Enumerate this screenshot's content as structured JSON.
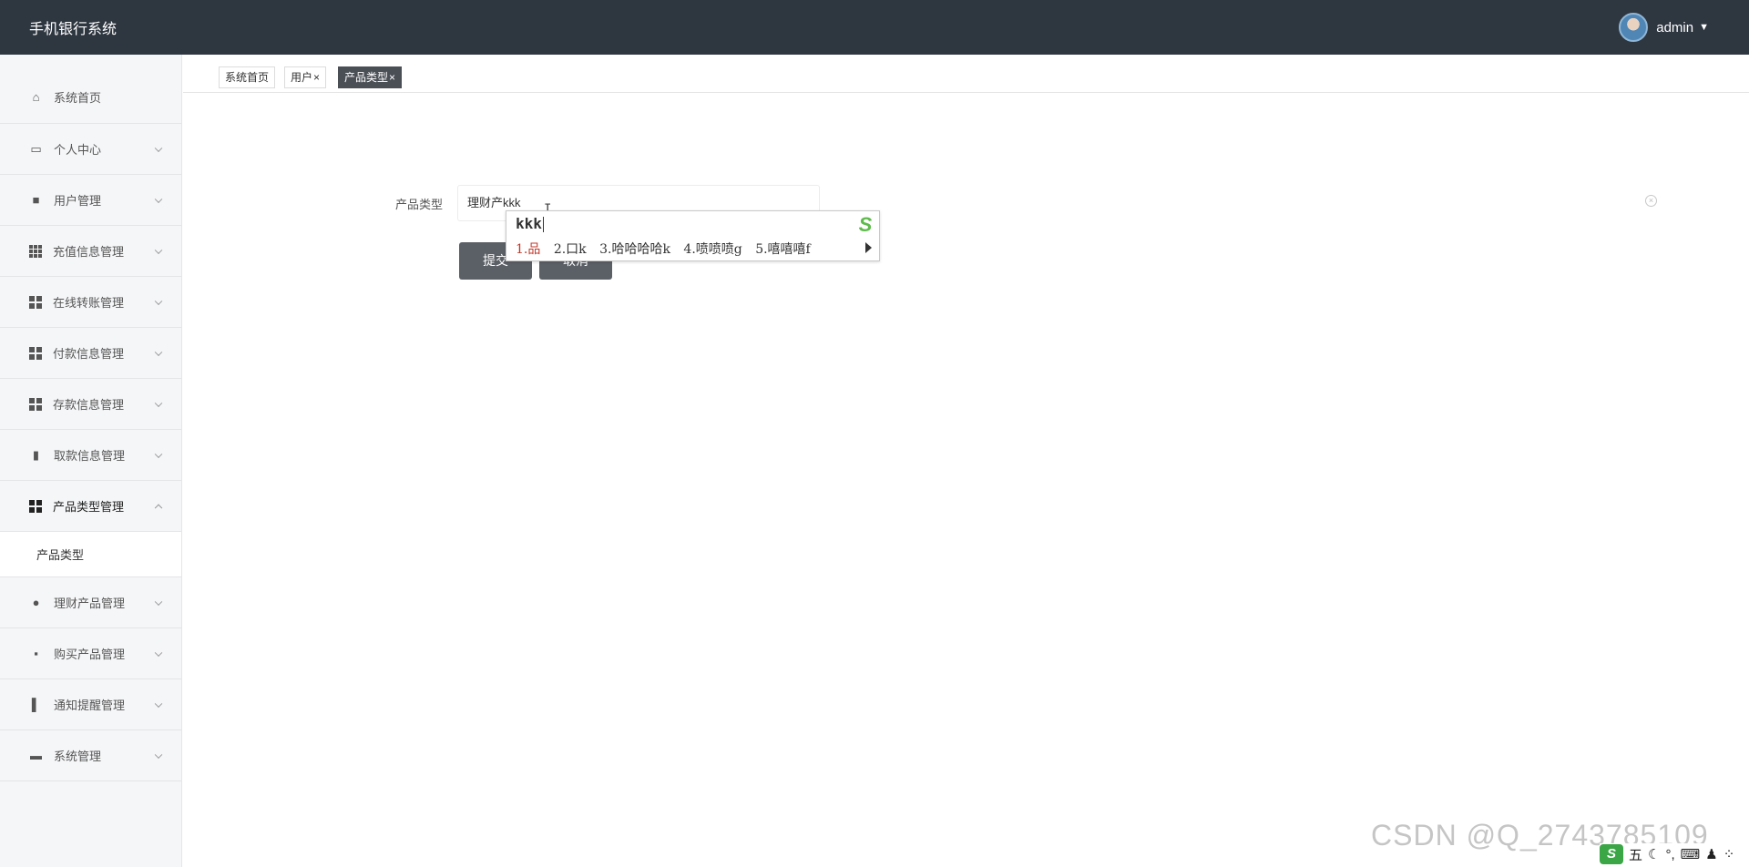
{
  "header": {
    "app_title": "手机银行系统",
    "username": "admin"
  },
  "sidebar": {
    "items": [
      {
        "label": "系统首页",
        "icon": "home-icon"
      },
      {
        "label": "个人中心",
        "icon": "card-icon"
      },
      {
        "label": "用户管理",
        "icon": "briefcase-icon"
      },
      {
        "label": "充值信息管理",
        "icon": "grid-icon"
      },
      {
        "label": "在线转账管理",
        "icon": "apps-icon"
      },
      {
        "label": "付款信息管理",
        "icon": "apps-icon"
      },
      {
        "label": "存款信息管理",
        "icon": "apps-icon"
      },
      {
        "label": "取款信息管理",
        "icon": "clipboard-icon"
      },
      {
        "label": "产品类型管理",
        "icon": "apps-icon"
      },
      {
        "label": "理财产品管理",
        "icon": "user-icon"
      },
      {
        "label": "购买产品管理",
        "icon": "chat-icon"
      },
      {
        "label": "通知提醒管理",
        "icon": "bar-icon"
      },
      {
        "label": "系统管理",
        "icon": "monitor-icon"
      }
    ],
    "subitem": {
      "label": "产品类型"
    }
  },
  "tabs": [
    {
      "label": "系统首页",
      "closable": false
    },
    {
      "label": "用户",
      "closable": true
    },
    {
      "label": "产品类型",
      "closable": true,
      "active": true
    }
  ],
  "tab_close_glyph": "×",
  "form": {
    "label": "产品类型",
    "value": "理财产kkk",
    "submit_label": "提交",
    "cancel_label": "取消"
  },
  "ime": {
    "composition": "kkk",
    "candidates": [
      "1.品",
      "2.口k",
      "3.哈哈哈哈k",
      "4.喷喷喷g",
      "5.嘻嘻嘻f"
    ],
    "logo": "S"
  },
  "watermark": "CSDN @Q_2743785109",
  "tray": {
    "ime_mode": "五",
    "logo": "S"
  },
  "colors": {
    "topbar": "#2e3640",
    "button": "#5b6066",
    "active_tab": "#4a4f56",
    "ime_selected": "#c0392b",
    "ime_logo": "#3aa645"
  }
}
